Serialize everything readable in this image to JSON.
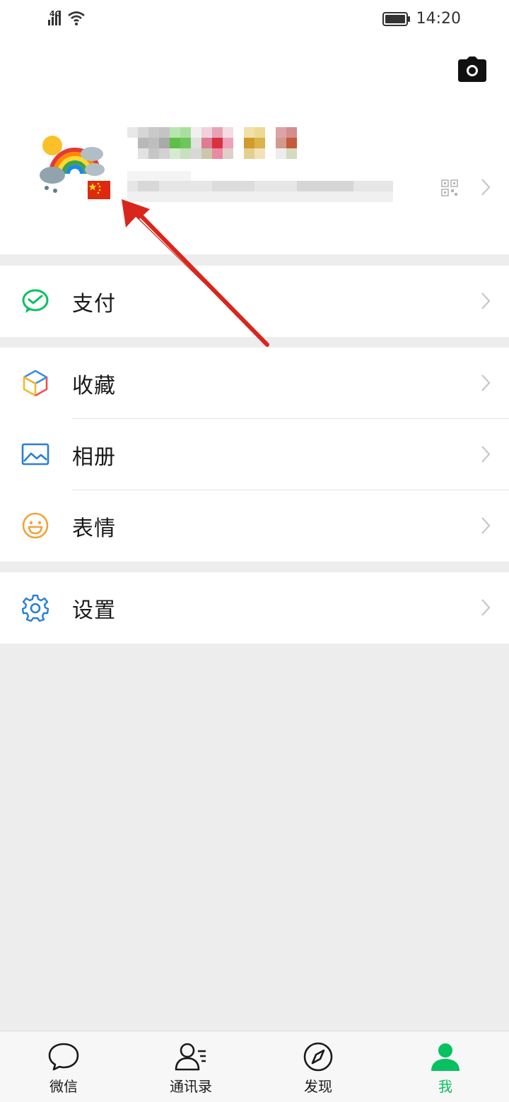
{
  "status": {
    "network": "4G",
    "time": "14:20"
  },
  "menu": {
    "pay": "支付",
    "favorites": "收藏",
    "album": "相册",
    "stickers": "表情",
    "settings": "设置"
  },
  "tabs": [
    {
      "label": "微信",
      "icon": "chat-bubble-icon"
    },
    {
      "label": "通讯录",
      "icon": "contacts-icon"
    },
    {
      "label": "发现",
      "icon": "compass-icon"
    },
    {
      "label": "我",
      "icon": "person-icon",
      "active": true
    }
  ],
  "colors": {
    "accent": "#07c160",
    "arrow": "#d9261c",
    "background": "#ededed"
  }
}
